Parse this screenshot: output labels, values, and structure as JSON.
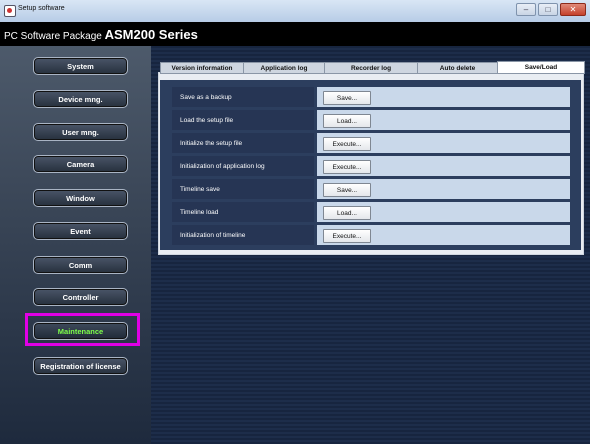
{
  "window": {
    "title": "Setup software",
    "buttons": {
      "minimize": "–",
      "maximize": "□",
      "close": "✕"
    }
  },
  "header": {
    "prefix": "PC Software Package ",
    "product": "ASM200 Series"
  },
  "sidebar": {
    "items": [
      {
        "label": "System"
      },
      {
        "label": "Device mng."
      },
      {
        "label": "User mng."
      },
      {
        "label": "Camera"
      },
      {
        "label": "Window"
      },
      {
        "label": "Event"
      },
      {
        "label": "Comm"
      },
      {
        "label": "Controller"
      },
      {
        "label": "Maintenance",
        "active": true
      },
      {
        "label": "Registration of license"
      }
    ]
  },
  "tabs": [
    {
      "label": "Version information"
    },
    {
      "label": "Application log"
    },
    {
      "label": "Recorder log"
    },
    {
      "label": "Auto delete"
    },
    {
      "label": "Save/Load",
      "active": true
    }
  ],
  "rows": [
    {
      "label": "Save as a backup",
      "action": "Save..."
    },
    {
      "label": "Load the setup file",
      "action": "Load..."
    },
    {
      "label": "Initialize the setup file",
      "action": "Execute..."
    },
    {
      "label": "Initialization of application log",
      "action": "Execute..."
    },
    {
      "label": "Timeline save",
      "action": "Save..."
    },
    {
      "label": "Timeline load",
      "action": "Load..."
    },
    {
      "label": "Initialization of timeline",
      "action": "Execute..."
    }
  ],
  "colors": {
    "active_menu_text": "#7dff4a",
    "highlight_border": "#e000e6",
    "header_bg": "#000000",
    "row_value_bg": "#c9d8ea"
  }
}
